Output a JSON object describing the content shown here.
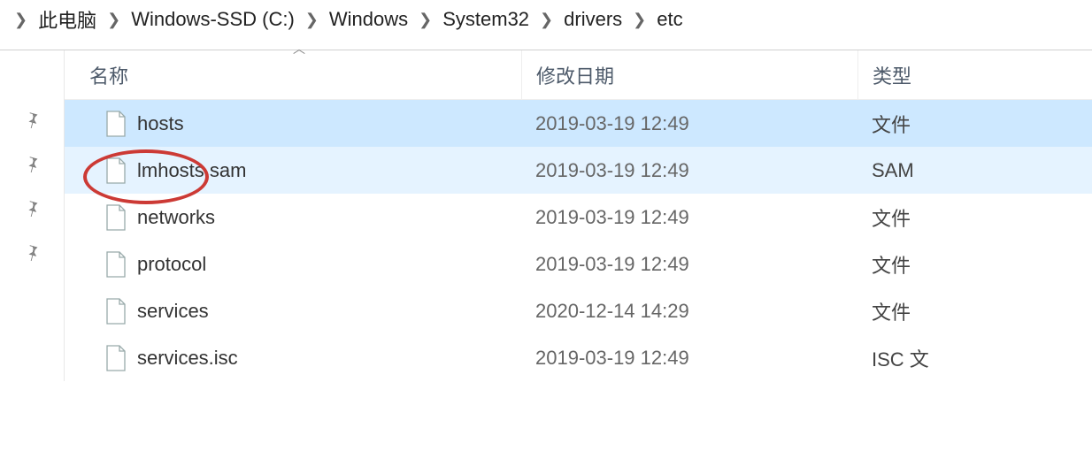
{
  "breadcrumb": {
    "items": [
      "此电脑",
      "Windows-SSD (C:)",
      "Windows",
      "System32",
      "drivers",
      "etc"
    ]
  },
  "headers": {
    "name": "名称",
    "date": "修改日期",
    "type": "类型"
  },
  "files": [
    {
      "name": "hosts",
      "date": "2019-03-19 12:49",
      "type": "文件",
      "state": "selected"
    },
    {
      "name": "lmhosts.sam",
      "date": "2019-03-19 12:49",
      "type": "SAM",
      "state": "hover"
    },
    {
      "name": "networks",
      "date": "2019-03-19 12:49",
      "type": "文件",
      "state": ""
    },
    {
      "name": "protocol",
      "date": "2019-03-19 12:49",
      "type": "文件",
      "state": ""
    },
    {
      "name": "services",
      "date": "2020-12-14 14:29",
      "type": "文件",
      "state": ""
    },
    {
      "name": "services.isc",
      "date": "2019-03-19 12:49",
      "type": "ISC 文",
      "state": ""
    }
  ]
}
